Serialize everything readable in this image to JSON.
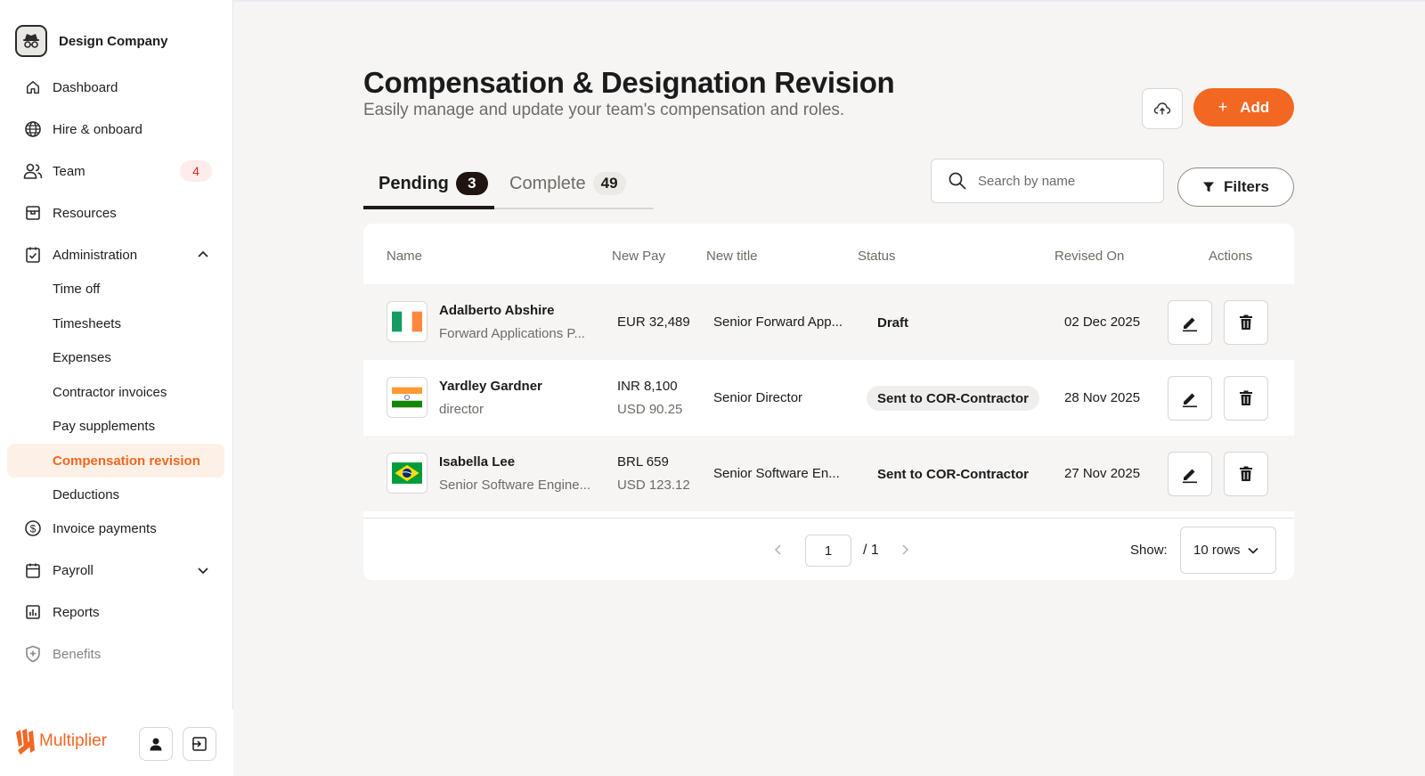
{
  "sidebar": {
    "company": "Design Company",
    "nav": [
      {
        "label": "Dashboard",
        "icon": "home-icon"
      },
      {
        "label": "Hire & onboard",
        "icon": "globe-icon"
      },
      {
        "label": "Team",
        "icon": "users-icon",
        "badge": "4"
      },
      {
        "label": "Resources",
        "icon": "box-icon"
      },
      {
        "label": "Administration",
        "icon": "clipboard-check-icon",
        "expanded": true
      }
    ],
    "admin_items": [
      {
        "label": "Time off"
      },
      {
        "label": "Timesheets"
      },
      {
        "label": "Expenses"
      },
      {
        "label": "Contractor invoices"
      },
      {
        "label": "Pay supplements"
      },
      {
        "label": "Compensation revision",
        "active": true
      },
      {
        "label": "Deductions"
      }
    ],
    "nav_bottom": [
      {
        "label": "Invoice payments",
        "icon": "dollar-circle-icon"
      },
      {
        "label": "Payroll",
        "icon": "calendar-icon"
      },
      {
        "label": "Reports",
        "icon": "bar-chart-icon"
      },
      {
        "label": "Benefits",
        "icon": "shield-plus-icon"
      }
    ],
    "footer": {
      "brand": "Multiplier"
    }
  },
  "page": {
    "title": "Compensation & Designation Revision",
    "subtitle": "Easily manage and update your team's compensation and roles.",
    "add_label": "Add"
  },
  "tabs": [
    {
      "label": "Pending",
      "count": "3",
      "active": true
    },
    {
      "label": "Complete",
      "count": "49"
    }
  ],
  "search": {
    "placeholder": "Search by name"
  },
  "filters_label": "Filters",
  "table": {
    "columns": [
      "Name",
      "New Pay",
      "New title",
      "Status",
      "Revised On",
      "Actions"
    ],
    "rows": [
      {
        "name": "Adalberto Abshire",
        "role": "Forward Applications P...",
        "pay": "EUR 32,489",
        "pay_secondary": "",
        "title": "Senior Forward App...",
        "status": "Draft",
        "revised": "02 Dec 2025",
        "flag": "ireland-flag-icon"
      },
      {
        "name": "Yardley Gardner",
        "role": "director",
        "pay": "INR 8,100",
        "pay_secondary": "USD 90.25",
        "title": "Senior Director",
        "status": "Sent to COR-Contractor",
        "revised": "28 Nov 2025",
        "flag": "india-flag-icon"
      },
      {
        "name": "Isabella Lee",
        "role": "Senior Software Engine...",
        "pay": "BRL 659",
        "pay_secondary": "USD 123.12",
        "title": "Senior Software En...",
        "status": "Sent to COR-Contractor",
        "revised": "27 Nov 2025",
        "flag": "brazil-flag-icon"
      }
    ]
  },
  "pagination": {
    "current": "1",
    "total": "/ 1",
    "show_label": "Show:",
    "rows_option": "10 rows"
  },
  "colors": {
    "accent": "#f26722",
    "badge_red": "#d92d20"
  }
}
